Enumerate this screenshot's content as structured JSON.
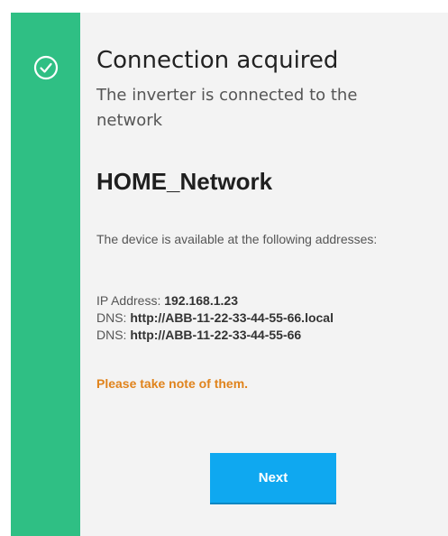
{
  "status": {
    "icon": "check-circle-icon",
    "title": "Connection acquired",
    "subtitle": "The inverter is connected to the network"
  },
  "network": {
    "name": "HOME_Network"
  },
  "addresses": {
    "description": "The device is available at the following addresses:",
    "ip_label": "IP Address:",
    "ip_value": "192.168.1.23",
    "dns1_label": "DNS:",
    "dns1_value": "http://ABB-11-22-33-44-55-66.local",
    "dns2_label": "DNS:",
    "dns2_value": "http://ABB-11-22-33-44-55-66"
  },
  "note": "Please take note of them.",
  "actions": {
    "next_label": "Next"
  },
  "colors": {
    "sidebar": "#2fbf84",
    "accent_button": "#0fa8f0",
    "note": "#e0831c"
  }
}
